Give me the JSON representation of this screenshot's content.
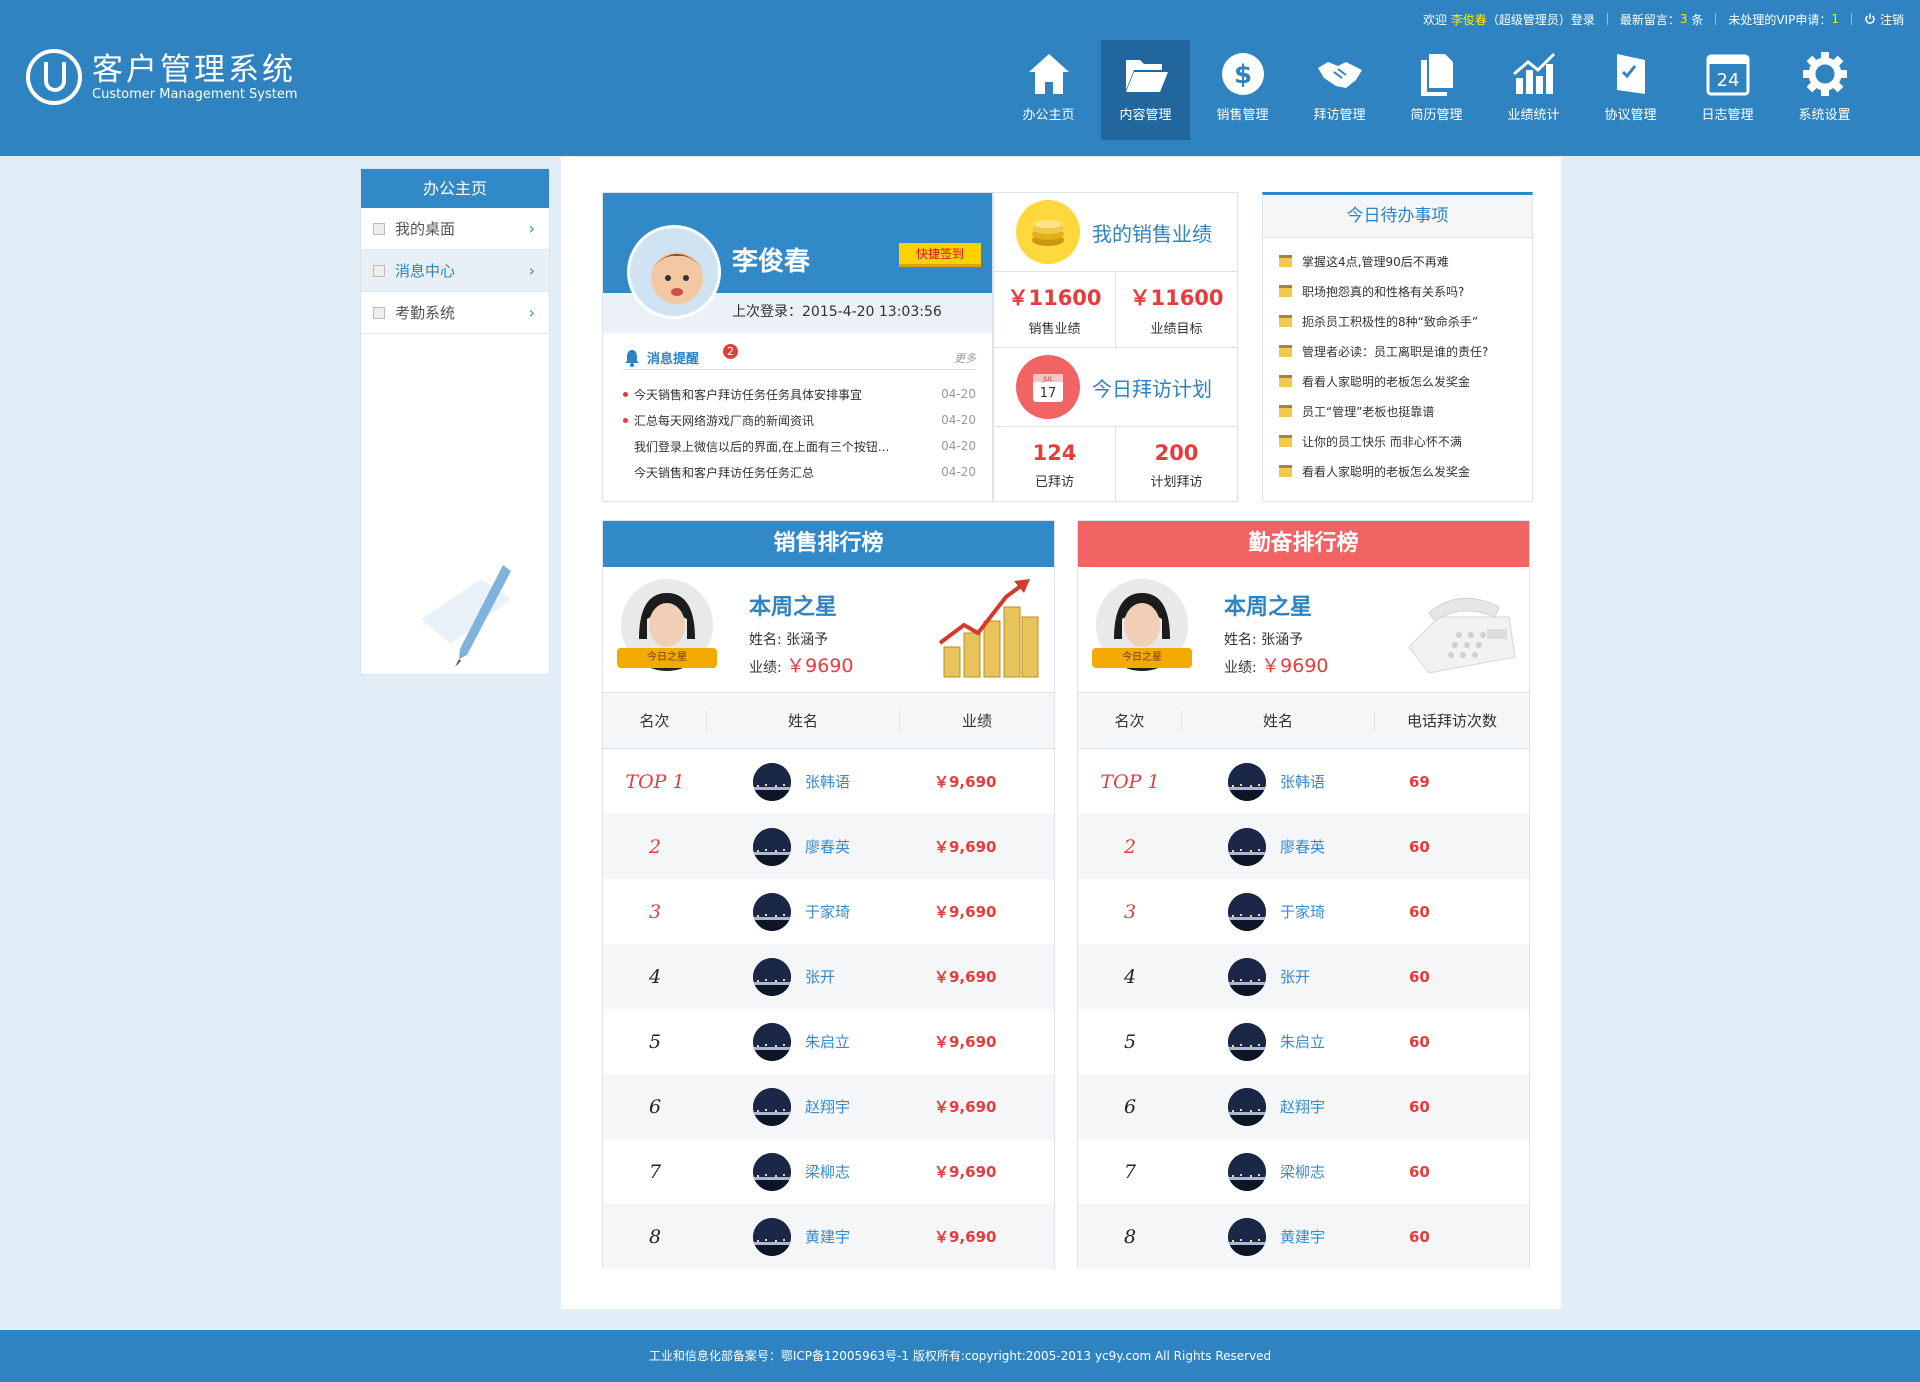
{
  "topbar": {
    "welcome_prefix": "欢迎",
    "user": "李俊春",
    "role_login": "（超级管理员）登录",
    "new_msg_label": "最新留言：",
    "new_msg_count": "3",
    "new_msg_unit": "条",
    "vip_label": "未处理的VIP申请：",
    "vip_count": "1",
    "logout": "注销"
  },
  "logo": {
    "cn": "客户管理系统",
    "en": "Customer Management System"
  },
  "nav": [
    {
      "label": "办公主页",
      "icon": "home-icon"
    },
    {
      "label": "内容管理",
      "icon": "folder-icon",
      "active": true
    },
    {
      "label": "销售管理",
      "icon": "dollar-coin-icon"
    },
    {
      "label": "拜访管理",
      "icon": "handshake-icon"
    },
    {
      "label": "简历管理",
      "icon": "documents-icon"
    },
    {
      "label": "业绩统计",
      "icon": "bar-chart-icon"
    },
    {
      "label": "协议管理",
      "icon": "checklist-icon"
    },
    {
      "label": "日志管理",
      "icon": "calendar-icon",
      "calendar_day": "24"
    },
    {
      "label": "系统设置",
      "icon": "gear-icon"
    }
  ],
  "sidebar": {
    "title": "办公主页",
    "items": [
      {
        "label": "我的桌面"
      },
      {
        "label": "消息中心",
        "active": true
      },
      {
        "label": "考勤系统"
      }
    ]
  },
  "profile": {
    "name": "李俊春",
    "sign_button": "快捷签到",
    "last_login": "上次登录：2015-4-20 13:03:56"
  },
  "messages": {
    "title": "消息提醒",
    "badge": "2",
    "more": "更多",
    "items": [
      {
        "text": "今天销售和客户拜访任务任务具体安排事宜",
        "date": "04-20",
        "dot": true
      },
      {
        "text": "汇总每天网络游戏厂商的新闻资讯",
        "date": "04-20",
        "dot": true
      },
      {
        "text": "我们登录上微信以后的界面,在上面有三个按钮...",
        "date": "04-20",
        "dot": false
      },
      {
        "text": "今天销售和客户拜访任务任务汇总",
        "date": "04-20",
        "dot": false
      }
    ]
  },
  "sales_perf": {
    "title": "我的销售业绩",
    "actual": "￥11600",
    "actual_label": "销售业绩",
    "target": "￥11600",
    "target_label": "业绩目标"
  },
  "visit_plan": {
    "title": "今日拜访计划",
    "calendar_month": "JUL",
    "calendar_day": "17",
    "visited": "124",
    "visited_label": "已拜访",
    "planned": "200",
    "planned_label": "计划拜访"
  },
  "todo": {
    "title": "今日待办事项",
    "items": [
      "掌握这4点,管理90后不再难",
      "职场抱怨真的和性格有关系吗?",
      "扼杀员工积极性的8种“致命杀手”",
      "管理者必读：员工离职是谁的责任?",
      "看看人家聪明的老板怎么发奖金",
      "员工“管理”老板也挺靠谱",
      "让你的员工快乐 而非心怀不满",
      "看看人家聪明的老板怎么发奖金"
    ]
  },
  "sales_rank": {
    "title": "销售排行榜",
    "star_title": "本周之星",
    "star_badge": "今日之星",
    "star_name": "姓名: 张涵予",
    "star_perf_label": "业绩:",
    "star_perf_value": "￥9690",
    "col1": "名次",
    "col2": "姓名",
    "col3": "业绩",
    "rows": [
      {
        "rank": "TOP 1",
        "name": "张韩语",
        "value": "￥9,690"
      },
      {
        "rank": "2",
        "name": "廖春英",
        "value": "￥9,690"
      },
      {
        "rank": "3",
        "name": "于家琦",
        "value": "￥9,690"
      },
      {
        "rank": "4",
        "name": "张开",
        "value": "￥9,690"
      },
      {
        "rank": "5",
        "name": "朱启立",
        "value": "￥9,690"
      },
      {
        "rank": "6",
        "name": "赵翔宇",
        "value": "￥9,690"
      },
      {
        "rank": "7",
        "name": "梁柳志",
        "value": "￥9,690"
      },
      {
        "rank": "8",
        "name": "黄建宇",
        "value": "￥9,690"
      }
    ]
  },
  "diligence_rank": {
    "title": "勤奋排行榜",
    "star_title": "本周之星",
    "star_badge": "今日之星",
    "star_name": "姓名: 张涵予",
    "star_perf_label": "业绩:",
    "star_perf_value": "￥9690",
    "col1": "名次",
    "col2": "姓名",
    "col3": "电话拜访次数",
    "rows": [
      {
        "rank": "TOP 1",
        "name": "张韩语",
        "value": "69"
      },
      {
        "rank": "2",
        "name": "廖春英",
        "value": "60"
      },
      {
        "rank": "3",
        "name": "于家琦",
        "value": "60"
      },
      {
        "rank": "4",
        "name": "张开",
        "value": "60"
      },
      {
        "rank": "5",
        "name": "朱启立",
        "value": "60"
      },
      {
        "rank": "6",
        "name": "赵翔宇",
        "value": "60"
      },
      {
        "rank": "7",
        "name": "梁柳志",
        "value": "60"
      },
      {
        "rank": "8",
        "name": "黄建宇",
        "value": "60"
      }
    ]
  },
  "footer": {
    "text": "工业和信息化部备案号：鄂ICP备12005963号-1 版权所有:copyright:2005-2013 yc9y.com All Rights Reserved"
  },
  "colors": {
    "primary": "#2f83c0",
    "accent_red": "#e63c3c",
    "diligence_header": "#f26464",
    "sign_button": "#ffd100"
  }
}
